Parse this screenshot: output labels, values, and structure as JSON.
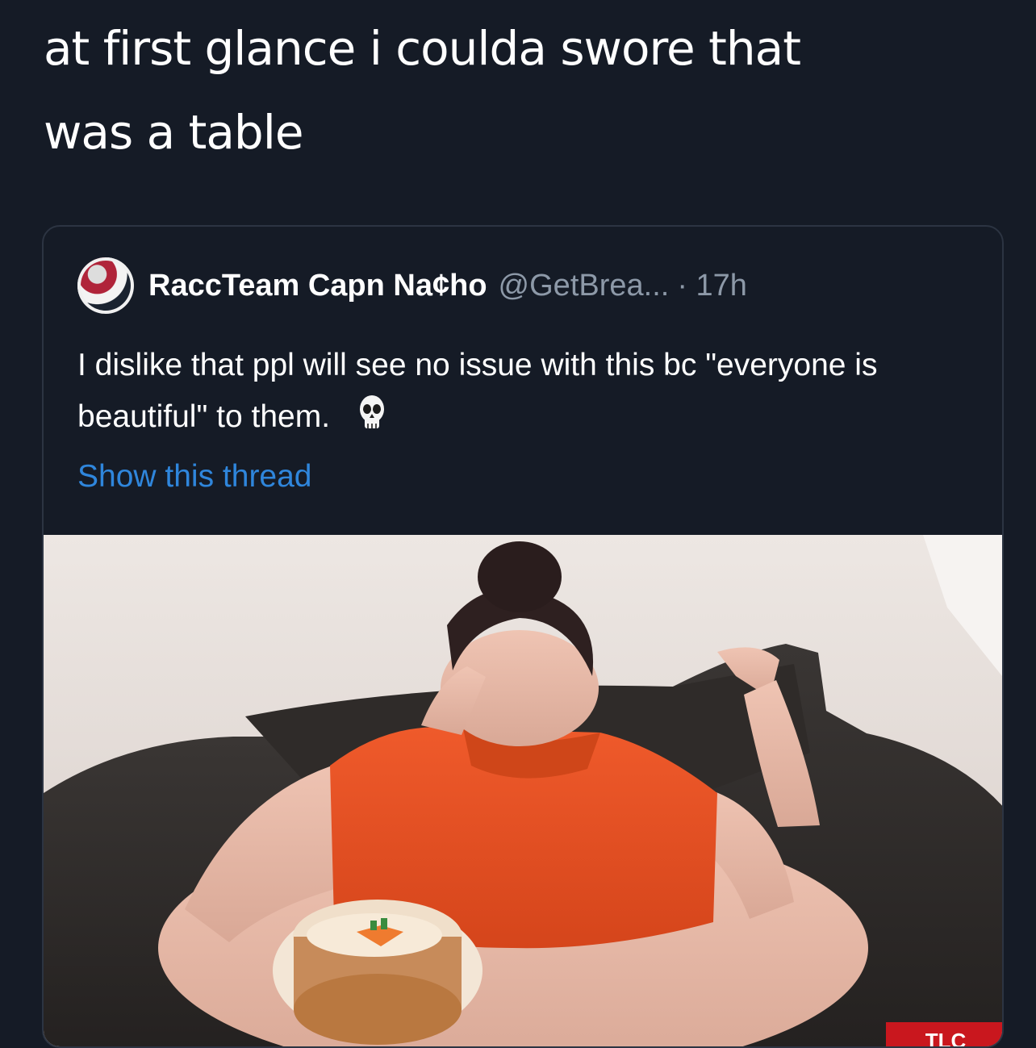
{
  "post": {
    "text": "at first glance i coulda swore that\nwas a table"
  },
  "quoted_tweet": {
    "display_name": "RaccTeam Capn Na¢ho",
    "handle": "@GetBrea...",
    "time": "· 17h",
    "text": "I dislike that ppl will see no issue with this bc \"everyone is beautiful\" to them.",
    "emoji": "skull-icon",
    "show_thread": "Show this thread",
    "media": {
      "watermark": "TLC"
    }
  },
  "colors": {
    "background": "#151b26",
    "text": "#ffffff",
    "secondary_text": "#8d99a8",
    "link": "#2f86dc",
    "card_border": "#2c3442"
  }
}
